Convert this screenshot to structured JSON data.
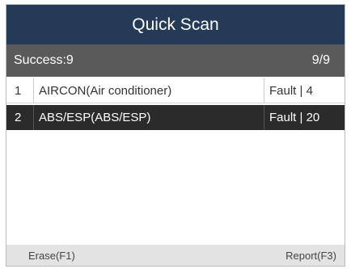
{
  "header": {
    "title": "Quick Scan"
  },
  "status": {
    "success_label": "Success:9",
    "progress": "9/9"
  },
  "rows": [
    {
      "index": "1",
      "system": "AIRCON(Air conditioner)",
      "fault": "Fault | 4"
    },
    {
      "index": "2",
      "system": "ABS/ESP(ABS/ESP)",
      "fault": "Fault | 20"
    }
  ],
  "footer": {
    "erase_label": "Erase(F1)",
    "report_label": "Report(F3)"
  },
  "colors": {
    "title_bar": "#243a57",
    "status_bar": "#5a5a5a",
    "selected_row": "#2b2b2b",
    "footer_bar": "#e3e3e3"
  }
}
